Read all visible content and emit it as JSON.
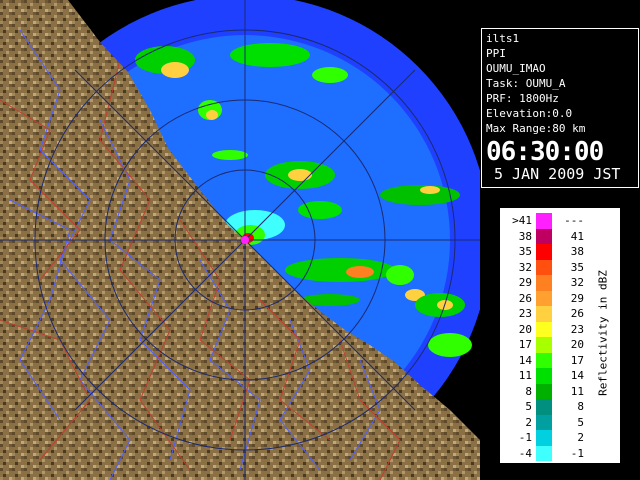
{
  "info": {
    "station": "ilts1",
    "product": "PPI",
    "site": "OUMU_IMAO",
    "task": "Task: OUMU_A",
    "prf": "PRF: 1800Hz",
    "elevation": "Elevation:0.0",
    "max_range": "Max Range:80 km",
    "time": "06:30:00",
    "date": "5 JAN 2009 JST"
  },
  "legend": {
    "unit": "Reflectivity in dBZ",
    "rows": [
      {
        "lo": ">41",
        "hi": "---",
        "color": "#ff20ff"
      },
      {
        "lo": "38",
        "hi": "41",
        "color": "#c00060"
      },
      {
        "lo": "35",
        "hi": "38",
        "color": "#ff0000"
      },
      {
        "lo": "32",
        "hi": "35",
        "color": "#ff5010"
      },
      {
        "lo": "29",
        "hi": "32",
        "color": "#ff8020"
      },
      {
        "lo": "26",
        "hi": "29",
        "color": "#ffa030"
      },
      {
        "lo": "23",
        "hi": "26",
        "color": "#ffd040"
      },
      {
        "lo": "20",
        "hi": "23",
        "color": "#ffff20"
      },
      {
        "lo": "17",
        "hi": "20",
        "color": "#a8ff00"
      },
      {
        "lo": "14",
        "hi": "17",
        "color": "#30ff00"
      },
      {
        "lo": "11",
        "hi": "14",
        "color": "#00e000"
      },
      {
        "lo": "8",
        "hi": "11",
        "color": "#00b000"
      },
      {
        "lo": "5",
        "hi": "8",
        "color": "#009080"
      },
      {
        "lo": "2",
        "hi": "5",
        "color": "#00a0a0"
      },
      {
        "lo": "-1",
        "hi": "2",
        "color": "#00d0e0"
      },
      {
        "lo": "-4",
        "hi": "-1",
        "color": "#40ffff"
      }
    ]
  },
  "colors": {
    "echo_background": "#1e6eff",
    "range_background": "#2040ff",
    "land": "#8a7044",
    "rivers": "#5060ff",
    "boundaries": "#c04030"
  }
}
